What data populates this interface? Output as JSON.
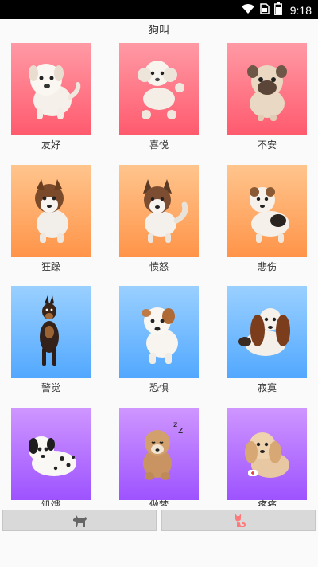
{
  "status_bar": {
    "time": "9:18",
    "icons": [
      "wifi-icon",
      "sim-icon",
      "battery-icon"
    ]
  },
  "app": {
    "title": "狗叫"
  },
  "grid": {
    "rows": [
      {
        "color": "red",
        "items": [
          {
            "label": "友好",
            "icon": "puppy-friendly-icon"
          },
          {
            "label": "喜悦",
            "icon": "poodle-joy-icon"
          },
          {
            "label": "不安",
            "icon": "pug-uneasy-icon"
          }
        ]
      },
      {
        "color": "orange",
        "items": [
          {
            "label": "狂躁",
            "icon": "husky-manic-icon"
          },
          {
            "label": "愤怒",
            "icon": "husky-angry-icon"
          },
          {
            "label": "悲伤",
            "icon": "terrier-sad-icon"
          }
        ]
      },
      {
        "color": "blue",
        "items": [
          {
            "label": "警觉",
            "icon": "doberman-alert-icon"
          },
          {
            "label": "恐惧",
            "icon": "bulldog-fear-icon"
          },
          {
            "label": "寂寞",
            "icon": "basset-lonely-icon"
          }
        ]
      },
      {
        "color": "purple",
        "items": [
          {
            "label": "饥饿",
            "icon": "dalmatian-hungry-icon"
          },
          {
            "label": "做梦",
            "icon": "puppy-dreaming-icon"
          },
          {
            "label": "疼痛",
            "icon": "spaniel-pain-icon"
          }
        ]
      }
    ]
  },
  "bottom_bar": {
    "left_button_icon": "dog-silhouette-icon",
    "right_button_icon": "cat-silhouette-icon",
    "left_icon_color": "#666666",
    "right_icon_color": "#ff7a7a"
  }
}
